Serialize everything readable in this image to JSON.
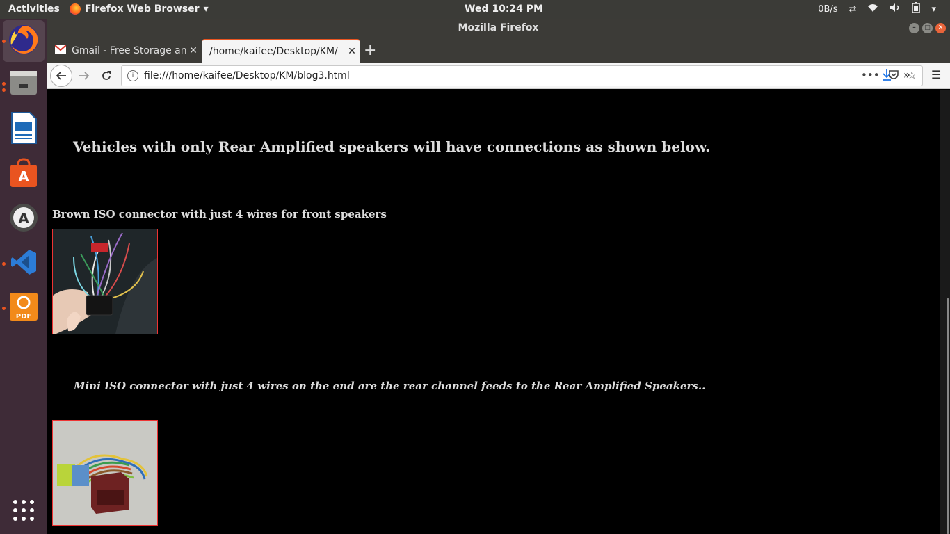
{
  "topbar": {
    "activities": "Activities",
    "app_menu": "Firefox Web Browser",
    "clock": "Wed 10:24 PM",
    "network_speed": "0B/s"
  },
  "window": {
    "title": "Mozilla Firefox"
  },
  "tabs": [
    {
      "label": "Gmail - Free Storage and",
      "active": false
    },
    {
      "label": "/home/kaifee/Desktop/KM/",
      "active": true
    }
  ],
  "navbar": {
    "url": "file:///home/kaifee/Desktop/KM/blog3.html"
  },
  "page": {
    "heading": "Vehicles with only Rear Amplified speakers will have connections as shown below.",
    "section1": "Brown ISO connector with just 4 wires for front speakers",
    "section2": "Mini ISO connector with just 4 wires on the end are the rear channel feeds to the Rear Amplified Speakers.."
  },
  "dock": {
    "items": [
      "firefox-icon",
      "files-icon",
      "writer-icon",
      "software-center-icon",
      "software-updater-icon",
      "vscode-icon",
      "pdf-editor-icon",
      "app-grid-icon"
    ]
  },
  "colors": {
    "accent": "#e95420",
    "page_bg": "#000000",
    "image_border": "#ee3333"
  }
}
